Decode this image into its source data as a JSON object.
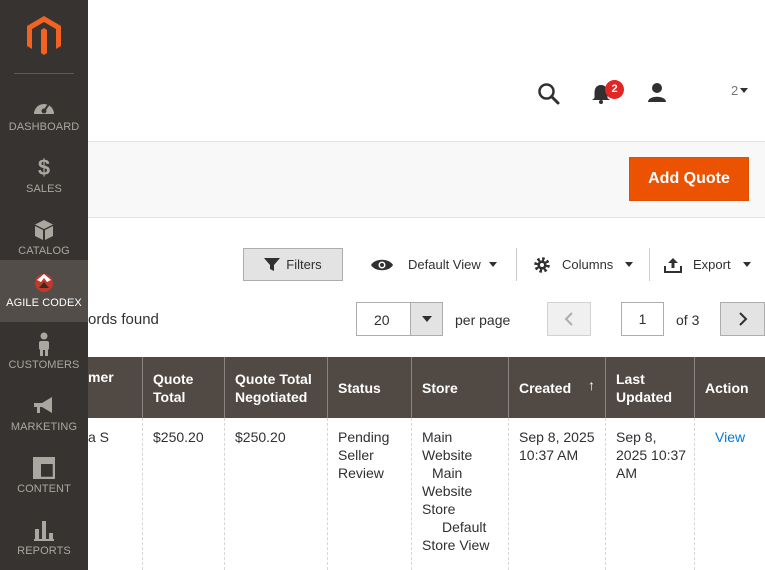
{
  "sidebar": {
    "items": [
      {
        "label": "DASHBOARD",
        "icon": "dashboard-icon"
      },
      {
        "label": "SALES",
        "icon": "dollar-icon"
      },
      {
        "label": "CATALOG",
        "icon": "box-icon"
      },
      {
        "label": "AGILE CODEX",
        "icon": "agile-codex-icon",
        "active": true
      },
      {
        "label": "CUSTOMERS",
        "icon": "person-icon"
      },
      {
        "label": "MARKETING",
        "icon": "megaphone-icon"
      },
      {
        "label": "CONTENT",
        "icon": "layout-icon"
      },
      {
        "label": "REPORTS",
        "icon": "bar-chart-icon"
      }
    ]
  },
  "header": {
    "notifications_count": "2",
    "user_fragment": "2"
  },
  "actions": {
    "add_quote": "Add Quote"
  },
  "toolbar": {
    "filters": "Filters",
    "view": "Default View",
    "columns": "Columns",
    "export": "Export"
  },
  "pager": {
    "records_text": "ords found",
    "per_page_value": "20",
    "per_page_label": "per page",
    "page": "1",
    "of_pages": "of 3"
  },
  "table": {
    "headers": [
      "mer",
      "Quote Total",
      "Quote Total Negotiated",
      "Status",
      "Store",
      "Created",
      "Last Updated",
      "Action"
    ],
    "sort_indicator": "↑",
    "rows": [
      {
        "customer": "a S",
        "quote_total": "$250.20",
        "negotiated": "$250.20",
        "status": "Pending Seller Review",
        "store_lines": [
          "Main",
          "Website",
          "Main",
          "Website",
          "Store",
          "Default",
          "Store View"
        ],
        "created_lines": [
          "Sep 8, 2025",
          "10:37 AM"
        ],
        "updated_lines": [
          "Sep 8,",
          "2025 10:37",
          "AM"
        ],
        "action": "View"
      }
    ]
  },
  "colors": {
    "sidebar_bg": "#373330",
    "sidebar_active": "#524d49",
    "brand_orange": "#eb5202",
    "table_header": "#514943",
    "link": "#007bdb",
    "badge": "#e22626"
  }
}
